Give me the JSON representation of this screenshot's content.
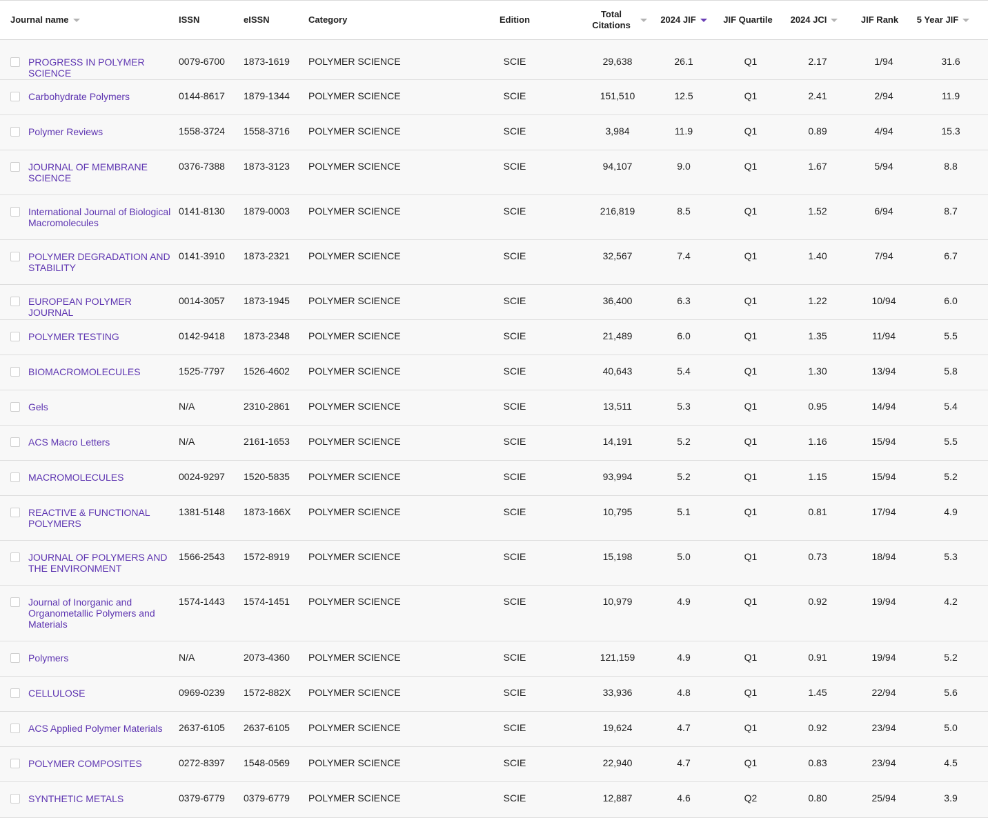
{
  "colors": {
    "link": "#5e35b1",
    "sort_active": "#6a3fb5",
    "row_bg": "#f8f8f8"
  },
  "headers": {
    "journal_name": "Journal name",
    "issn": "ISSN",
    "eissn": "eISSN",
    "category": "Category",
    "edition": "Edition",
    "total_citations_line1": "Total",
    "total_citations_line2": "Citations",
    "jif": "2024 JIF",
    "quartile": "JIF Quartile",
    "jci": "2024 JCI",
    "rank": "JIF Rank",
    "five_year_jif": "5 Year JIF"
  },
  "rows": [
    {
      "name": "PROGRESS IN POLYMER SCIENCE",
      "issn": "0079-6700",
      "eissn": "1873-1619",
      "category": "POLYMER SCIENCE",
      "edition": "SCIE",
      "citations": "29,638",
      "jif": "26.1",
      "quartile": "Q1",
      "jci": "2.17",
      "rank": "1/94",
      "jif5": "31.6"
    },
    {
      "name": "Carbohydrate Polymers",
      "issn": "0144-8617",
      "eissn": "1879-1344",
      "category": "POLYMER SCIENCE",
      "edition": "SCIE",
      "citations": "151,510",
      "jif": "12.5",
      "quartile": "Q1",
      "jci": "2.41",
      "rank": "2/94",
      "jif5": "11.9"
    },
    {
      "name": "Polymer Reviews",
      "issn": "1558-3724",
      "eissn": "1558-3716",
      "category": "POLYMER SCIENCE",
      "edition": "SCIE",
      "citations": "3,984",
      "jif": "11.9",
      "quartile": "Q1",
      "jci": "0.89",
      "rank": "4/94",
      "jif5": "15.3"
    },
    {
      "name": "JOURNAL OF MEMBRANE SCIENCE",
      "issn": "0376-7388",
      "eissn": "1873-3123",
      "category": "POLYMER SCIENCE",
      "edition": "SCIE",
      "citations": "94,107",
      "jif": "9.0",
      "quartile": "Q1",
      "jci": "1.67",
      "rank": "5/94",
      "jif5": "8.8"
    },
    {
      "name": "International Journal of Biological Macromolecules",
      "issn": "0141-8130",
      "eissn": "1879-0003",
      "category": "POLYMER SCIENCE",
      "edition": "SCIE",
      "citations": "216,819",
      "jif": "8.5",
      "quartile": "Q1",
      "jci": "1.52",
      "rank": "6/94",
      "jif5": "8.7"
    },
    {
      "name": "POLYMER DEGRADATION AND STABILITY",
      "issn": "0141-3910",
      "eissn": "1873-2321",
      "category": "POLYMER SCIENCE",
      "edition": "SCIE",
      "citations": "32,567",
      "jif": "7.4",
      "quartile": "Q1",
      "jci": "1.40",
      "rank": "7/94",
      "jif5": "6.7"
    },
    {
      "name": "EUROPEAN POLYMER JOURNAL",
      "issn": "0014-3057",
      "eissn": "1873-1945",
      "category": "POLYMER SCIENCE",
      "edition": "SCIE",
      "citations": "36,400",
      "jif": "6.3",
      "quartile": "Q1",
      "jci": "1.22",
      "rank": "10/94",
      "jif5": "6.0"
    },
    {
      "name": "POLYMER TESTING",
      "issn": "0142-9418",
      "eissn": "1873-2348",
      "category": "POLYMER SCIENCE",
      "edition": "SCIE",
      "citations": "21,489",
      "jif": "6.0",
      "quartile": "Q1",
      "jci": "1.35",
      "rank": "11/94",
      "jif5": "5.5"
    },
    {
      "name": "BIOMACROMOLECULES",
      "issn": "1525-7797",
      "eissn": "1526-4602",
      "category": "POLYMER SCIENCE",
      "edition": "SCIE",
      "citations": "40,643",
      "jif": "5.4",
      "quartile": "Q1",
      "jci": "1.30",
      "rank": "13/94",
      "jif5": "5.8"
    },
    {
      "name": "Gels",
      "issn": "N/A",
      "eissn": "2310-2861",
      "category": "POLYMER SCIENCE",
      "edition": "SCIE",
      "citations": "13,511",
      "jif": "5.3",
      "quartile": "Q1",
      "jci": "0.95",
      "rank": "14/94",
      "jif5": "5.4"
    },
    {
      "name": "ACS Macro Letters",
      "issn": "N/A",
      "eissn": "2161-1653",
      "category": "POLYMER SCIENCE",
      "edition": "SCIE",
      "citations": "14,191",
      "jif": "5.2",
      "quartile": "Q1",
      "jci": "1.16",
      "rank": "15/94",
      "jif5": "5.5"
    },
    {
      "name": "MACROMOLECULES",
      "issn": "0024-9297",
      "eissn": "1520-5835",
      "category": "POLYMER SCIENCE",
      "edition": "SCIE",
      "citations": "93,994",
      "jif": "5.2",
      "quartile": "Q1",
      "jci": "1.15",
      "rank": "15/94",
      "jif5": "5.2"
    },
    {
      "name": "REACTIVE & FUNCTIONAL POLYMERS",
      "issn": "1381-5148",
      "eissn": "1873-166X",
      "category": "POLYMER SCIENCE",
      "edition": "SCIE",
      "citations": "10,795",
      "jif": "5.1",
      "quartile": "Q1",
      "jci": "0.81",
      "rank": "17/94",
      "jif5": "4.9"
    },
    {
      "name": "JOURNAL OF POLYMERS AND THE ENVIRONMENT",
      "issn": "1566-2543",
      "eissn": "1572-8919",
      "category": "POLYMER SCIENCE",
      "edition": "SCIE",
      "citations": "15,198",
      "jif": "5.0",
      "quartile": "Q1",
      "jci": "0.73",
      "rank": "18/94",
      "jif5": "5.3"
    },
    {
      "name": "Journal of Inorganic and Organometallic Polymers and Materials",
      "issn": "1574-1443",
      "eissn": "1574-1451",
      "category": "POLYMER SCIENCE",
      "edition": "SCIE",
      "citations": "10,979",
      "jif": "4.9",
      "quartile": "Q1",
      "jci": "0.92",
      "rank": "19/94",
      "jif5": "4.2"
    },
    {
      "name": "Polymers",
      "issn": "N/A",
      "eissn": "2073-4360",
      "category": "POLYMER SCIENCE",
      "edition": "SCIE",
      "citations": "121,159",
      "jif": "4.9",
      "quartile": "Q1",
      "jci": "0.91",
      "rank": "19/94",
      "jif5": "5.2"
    },
    {
      "name": "CELLULOSE",
      "issn": "0969-0239",
      "eissn": "1572-882X",
      "category": "POLYMER SCIENCE",
      "edition": "SCIE",
      "citations": "33,936",
      "jif": "4.8",
      "quartile": "Q1",
      "jci": "1.45",
      "rank": "22/94",
      "jif5": "5.6"
    },
    {
      "name": "ACS Applied Polymer Materials",
      "issn": "2637-6105",
      "eissn": "2637-6105",
      "category": "POLYMER SCIENCE",
      "edition": "SCIE",
      "citations": "19,624",
      "jif": "4.7",
      "quartile": "Q1",
      "jci": "0.92",
      "rank": "23/94",
      "jif5": "5.0"
    },
    {
      "name": "POLYMER COMPOSITES",
      "issn": "0272-8397",
      "eissn": "1548-0569",
      "category": "POLYMER SCIENCE",
      "edition": "SCIE",
      "citations": "22,940",
      "jif": "4.7",
      "quartile": "Q1",
      "jci": "0.83",
      "rank": "23/94",
      "jif5": "4.5"
    },
    {
      "name": "SYNTHETIC METALS",
      "issn": "0379-6779",
      "eissn": "0379-6779",
      "category": "POLYMER SCIENCE",
      "edition": "SCIE",
      "citations": "12,887",
      "jif": "4.6",
      "quartile": "Q2",
      "jci": "0.80",
      "rank": "25/94",
      "jif5": "3.9"
    }
  ]
}
